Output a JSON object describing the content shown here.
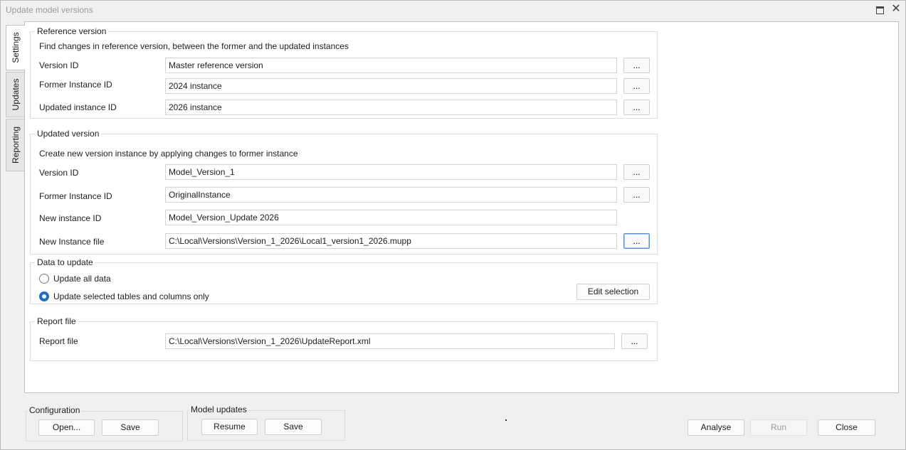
{
  "window": {
    "title": "Update model versions"
  },
  "tabs": [
    {
      "label": "Settings",
      "active": true
    },
    {
      "label": "Updates",
      "active": false
    },
    {
      "label": "Reporting",
      "active": false
    }
  ],
  "reference_version": {
    "legend": "Reference version",
    "description": "Find changes in reference version, between the former and the updated instances",
    "version_id": {
      "label": "Version ID",
      "value": "Master reference version"
    },
    "former_instance_id": {
      "label": "Former Instance ID",
      "value": "2024 instance"
    },
    "updated_instance_id": {
      "label": "Updated instance ID",
      "value": "2026 instance"
    }
  },
  "updated_version": {
    "legend": "Updated version",
    "description": "Create new version instance by applying changes to former instance",
    "version_id": {
      "label": "Version ID",
      "value": "Model_Version_1"
    },
    "former_instance_id": {
      "label": "Former Instance ID",
      "value": "OriginalInstance"
    },
    "new_instance_id": {
      "label": "New instance ID",
      "value": "Model_Version_Update 2026"
    },
    "new_instance_file": {
      "label": "New Instance file",
      "value": "C:\\Local\\Versions\\Version_1_2026\\Local1_version1_2026.mupp"
    }
  },
  "data_to_update": {
    "legend": "Data to update",
    "option_all": "Update all data",
    "option_selected": "Update selected tables and columns only",
    "selected": "option_selected",
    "edit_selection_label": "Edit selection"
  },
  "report_file": {
    "legend": "Report file",
    "label": "Report file",
    "value": "C:\\Local\\Versions\\Version_1_2026\\UpdateReport.xml"
  },
  "browse_label": "...",
  "configuration": {
    "legend": "Configuration",
    "open_label": "Open...",
    "save_label": "Save"
  },
  "model_updates": {
    "legend": "Model updates",
    "resume_label": "Resume",
    "save_label": "Save"
  },
  "actions": {
    "analyse_label": "Analyse",
    "run_label": "Run",
    "close_label": "Close"
  }
}
